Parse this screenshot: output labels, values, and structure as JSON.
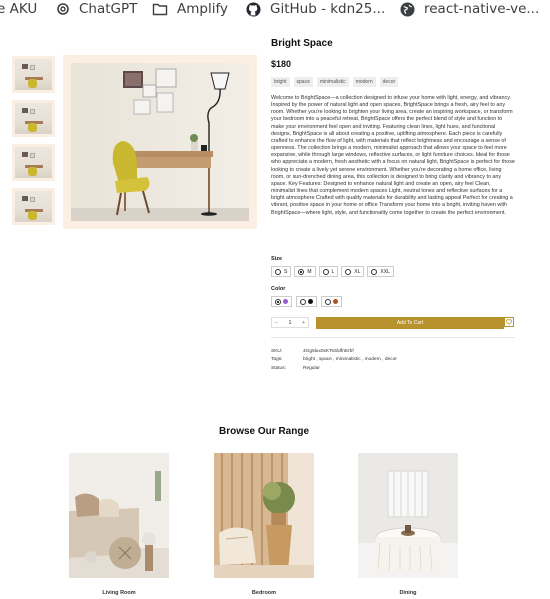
{
  "bookmarks": [
    {
      "label": "e AKU",
      "icon": "bookmark-none"
    },
    {
      "label": "ChatGPT",
      "icon": "chatgpt-icon"
    },
    {
      "label": "Amplify",
      "icon": "folder-icon"
    },
    {
      "label": "GitHub - kdn25...",
      "icon": "github-icon"
    },
    {
      "label": "react-native-ve...",
      "icon": "globe-icon"
    }
  ],
  "product": {
    "title": "Bright Space",
    "price": "$180",
    "tags": [
      "bright",
      "space",
      "minimalistic",
      "modern",
      "decor"
    ],
    "description": "Welcome to BrightSpace—a collection designed to infuse your home with light, energy, and vibrancy. Inspired by the power of natural light and open spaces, BrightSpace brings a fresh, airy feel to any room. Whether you're looking to brighten your living area, create an inspiring workspace, or transform your bedroom into a peaceful retreat, BrightSpace offers the perfect blend of style and function to make your environment feel open and inviting. Featuring clean lines, light hues, and functional designs, BrightSpace is all about creating a positive, uplifting atmosphere. Each piece is carefully crafted to enhance the flow of light, with materials that reflect brightness and encourage a sense of openness. The collection brings a modern, minimalist approach that allows your space to feel more expansive, while through large windows, reflective surfaces, or light furniture choices. Ideal for those who appreciate a modern, fresh aesthetic with a focus on natural light, BrightSpace is perfect for those looking to create a lively yet serene environment. Whether you're decorating a home office, living room, or sun-drenched dining area, this collection is designed to bring clarity and vibrancy to any space. Key Features: Designed to enhance natural light and create an open, airy feel Clean, minimalist lines that complement modern spaces Light, neutral tones and reflective surfaces for a bright atmosphere Crafted with quality materials for durability and lasting appeal Perfect for creating a vibrant, positive space in your home or office Transform your home into a bright, inviting haven with BrightSpace—where light, style, and functionality come together to create the perfect environment.",
    "size_label": "Size",
    "sizes": [
      {
        "label": "S",
        "selected": false
      },
      {
        "label": "M",
        "selected": true
      },
      {
        "label": "L",
        "selected": false
      },
      {
        "label": "XL",
        "selected": false
      },
      {
        "label": "XXL",
        "selected": false
      }
    ],
    "color_label": "Color",
    "colors": [
      {
        "swatch": "#9b59d6",
        "selected": true
      },
      {
        "swatch": "#111111",
        "selected": false
      },
      {
        "swatch": "#b5501c",
        "selected": false
      }
    ],
    "quantity": "1",
    "minus": "−",
    "plus": "+",
    "add_to_cart": "Add To Cart",
    "meta": [
      {
        "key": "SKU:",
        "value": "4Gg5lux0xKTsSldfnErbf"
      },
      {
        "key": "Tags:",
        "value": "bright , space , minimalistic , modern , decor"
      },
      {
        "key": "Status:",
        "value": "Regular"
      }
    ]
  },
  "browse": {
    "title": "Browse Our Range",
    "categories": [
      {
        "name": "Living Room"
      },
      {
        "name": "Bedroom"
      },
      {
        "name": "Dining"
      }
    ]
  },
  "colors": {
    "accent": "#b8922c",
    "image_frame": "#fbeee2"
  }
}
